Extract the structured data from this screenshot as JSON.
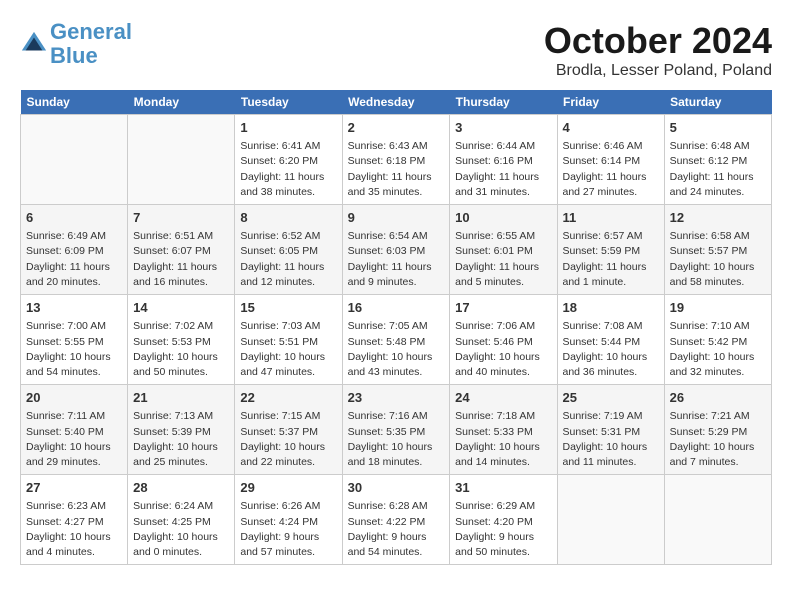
{
  "header": {
    "logo_line1": "General",
    "logo_line2": "Blue",
    "month_title": "October 2024",
    "location": "Brodla, Lesser Poland, Poland"
  },
  "weekdays": [
    "Sunday",
    "Monday",
    "Tuesday",
    "Wednesday",
    "Thursday",
    "Friday",
    "Saturday"
  ],
  "weeks": [
    [
      {
        "day": "",
        "sunrise": "",
        "sunset": "",
        "daylight": ""
      },
      {
        "day": "",
        "sunrise": "",
        "sunset": "",
        "daylight": ""
      },
      {
        "day": "1",
        "sunrise": "Sunrise: 6:41 AM",
        "sunset": "Sunset: 6:20 PM",
        "daylight": "Daylight: 11 hours and 38 minutes."
      },
      {
        "day": "2",
        "sunrise": "Sunrise: 6:43 AM",
        "sunset": "Sunset: 6:18 PM",
        "daylight": "Daylight: 11 hours and 35 minutes."
      },
      {
        "day": "3",
        "sunrise": "Sunrise: 6:44 AM",
        "sunset": "Sunset: 6:16 PM",
        "daylight": "Daylight: 11 hours and 31 minutes."
      },
      {
        "day": "4",
        "sunrise": "Sunrise: 6:46 AM",
        "sunset": "Sunset: 6:14 PM",
        "daylight": "Daylight: 11 hours and 27 minutes."
      },
      {
        "day": "5",
        "sunrise": "Sunrise: 6:48 AM",
        "sunset": "Sunset: 6:12 PM",
        "daylight": "Daylight: 11 hours and 24 minutes."
      }
    ],
    [
      {
        "day": "6",
        "sunrise": "Sunrise: 6:49 AM",
        "sunset": "Sunset: 6:09 PM",
        "daylight": "Daylight: 11 hours and 20 minutes."
      },
      {
        "day": "7",
        "sunrise": "Sunrise: 6:51 AM",
        "sunset": "Sunset: 6:07 PM",
        "daylight": "Daylight: 11 hours and 16 minutes."
      },
      {
        "day": "8",
        "sunrise": "Sunrise: 6:52 AM",
        "sunset": "Sunset: 6:05 PM",
        "daylight": "Daylight: 11 hours and 12 minutes."
      },
      {
        "day": "9",
        "sunrise": "Sunrise: 6:54 AM",
        "sunset": "Sunset: 6:03 PM",
        "daylight": "Daylight: 11 hours and 9 minutes."
      },
      {
        "day": "10",
        "sunrise": "Sunrise: 6:55 AM",
        "sunset": "Sunset: 6:01 PM",
        "daylight": "Daylight: 11 hours and 5 minutes."
      },
      {
        "day": "11",
        "sunrise": "Sunrise: 6:57 AM",
        "sunset": "Sunset: 5:59 PM",
        "daylight": "Daylight: 11 hours and 1 minute."
      },
      {
        "day": "12",
        "sunrise": "Sunrise: 6:58 AM",
        "sunset": "Sunset: 5:57 PM",
        "daylight": "Daylight: 10 hours and 58 minutes."
      }
    ],
    [
      {
        "day": "13",
        "sunrise": "Sunrise: 7:00 AM",
        "sunset": "Sunset: 5:55 PM",
        "daylight": "Daylight: 10 hours and 54 minutes."
      },
      {
        "day": "14",
        "sunrise": "Sunrise: 7:02 AM",
        "sunset": "Sunset: 5:53 PM",
        "daylight": "Daylight: 10 hours and 50 minutes."
      },
      {
        "day": "15",
        "sunrise": "Sunrise: 7:03 AM",
        "sunset": "Sunset: 5:51 PM",
        "daylight": "Daylight: 10 hours and 47 minutes."
      },
      {
        "day": "16",
        "sunrise": "Sunrise: 7:05 AM",
        "sunset": "Sunset: 5:48 PM",
        "daylight": "Daylight: 10 hours and 43 minutes."
      },
      {
        "day": "17",
        "sunrise": "Sunrise: 7:06 AM",
        "sunset": "Sunset: 5:46 PM",
        "daylight": "Daylight: 10 hours and 40 minutes."
      },
      {
        "day": "18",
        "sunrise": "Sunrise: 7:08 AM",
        "sunset": "Sunset: 5:44 PM",
        "daylight": "Daylight: 10 hours and 36 minutes."
      },
      {
        "day": "19",
        "sunrise": "Sunrise: 7:10 AM",
        "sunset": "Sunset: 5:42 PM",
        "daylight": "Daylight: 10 hours and 32 minutes."
      }
    ],
    [
      {
        "day": "20",
        "sunrise": "Sunrise: 7:11 AM",
        "sunset": "Sunset: 5:40 PM",
        "daylight": "Daylight: 10 hours and 29 minutes."
      },
      {
        "day": "21",
        "sunrise": "Sunrise: 7:13 AM",
        "sunset": "Sunset: 5:39 PM",
        "daylight": "Daylight: 10 hours and 25 minutes."
      },
      {
        "day": "22",
        "sunrise": "Sunrise: 7:15 AM",
        "sunset": "Sunset: 5:37 PM",
        "daylight": "Daylight: 10 hours and 22 minutes."
      },
      {
        "day": "23",
        "sunrise": "Sunrise: 7:16 AM",
        "sunset": "Sunset: 5:35 PM",
        "daylight": "Daylight: 10 hours and 18 minutes."
      },
      {
        "day": "24",
        "sunrise": "Sunrise: 7:18 AM",
        "sunset": "Sunset: 5:33 PM",
        "daylight": "Daylight: 10 hours and 14 minutes."
      },
      {
        "day": "25",
        "sunrise": "Sunrise: 7:19 AM",
        "sunset": "Sunset: 5:31 PM",
        "daylight": "Daylight: 10 hours and 11 minutes."
      },
      {
        "day": "26",
        "sunrise": "Sunrise: 7:21 AM",
        "sunset": "Sunset: 5:29 PM",
        "daylight": "Daylight: 10 hours and 7 minutes."
      }
    ],
    [
      {
        "day": "27",
        "sunrise": "Sunrise: 6:23 AM",
        "sunset": "Sunset: 4:27 PM",
        "daylight": "Daylight: 10 hours and 4 minutes."
      },
      {
        "day": "28",
        "sunrise": "Sunrise: 6:24 AM",
        "sunset": "Sunset: 4:25 PM",
        "daylight": "Daylight: 10 hours and 0 minutes."
      },
      {
        "day": "29",
        "sunrise": "Sunrise: 6:26 AM",
        "sunset": "Sunset: 4:24 PM",
        "daylight": "Daylight: 9 hours and 57 minutes."
      },
      {
        "day": "30",
        "sunrise": "Sunrise: 6:28 AM",
        "sunset": "Sunset: 4:22 PM",
        "daylight": "Daylight: 9 hours and 54 minutes."
      },
      {
        "day": "31",
        "sunrise": "Sunrise: 6:29 AM",
        "sunset": "Sunset: 4:20 PM",
        "daylight": "Daylight: 9 hours and 50 minutes."
      },
      {
        "day": "",
        "sunrise": "",
        "sunset": "",
        "daylight": ""
      },
      {
        "day": "",
        "sunrise": "",
        "sunset": "",
        "daylight": ""
      }
    ]
  ]
}
